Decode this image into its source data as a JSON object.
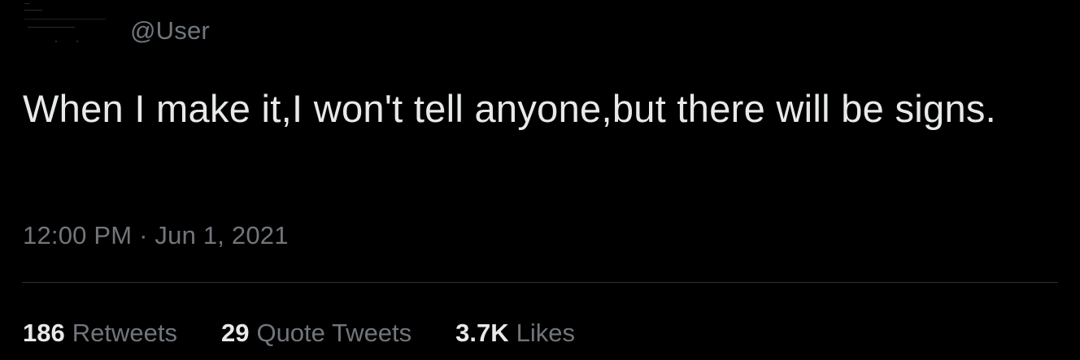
{
  "tweet": {
    "handle": "@User",
    "text": "When I make it,I won't tell anyone,but there will be signs.",
    "timestamp": "12:00 PM · Jun 1, 2021"
  },
  "stats": [
    {
      "value": "186",
      "label": "Retweets"
    },
    {
      "value": "29",
      "label": "Quote Tweets"
    },
    {
      "value": "3.7K",
      "label": "Likes"
    }
  ],
  "colors": {
    "background": "#000000",
    "primary_text": "#e7e9ea",
    "secondary_text": "#71767b",
    "divider": "#2f3336"
  }
}
